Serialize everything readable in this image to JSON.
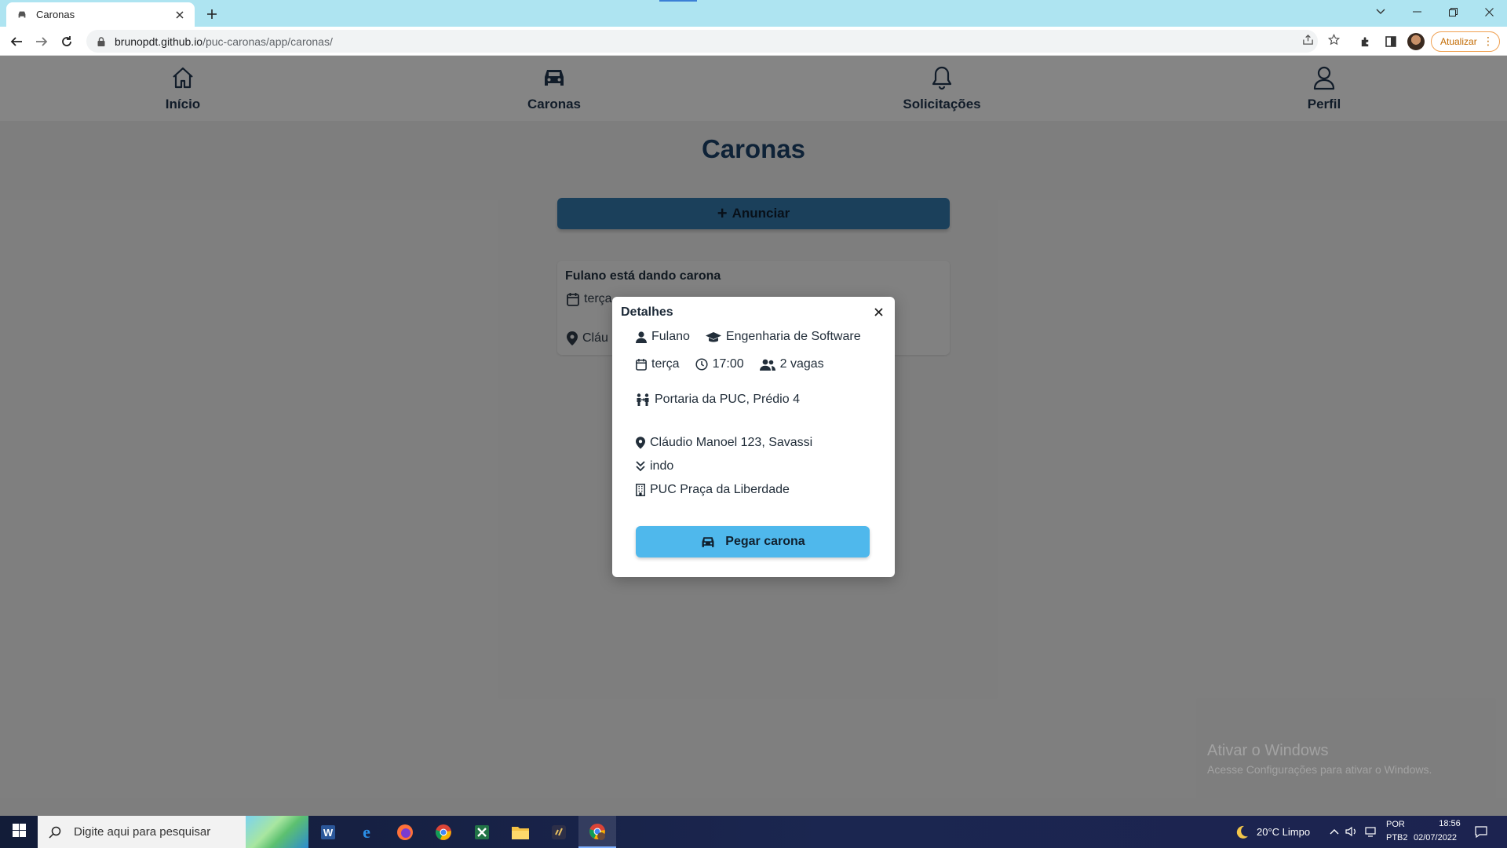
{
  "browser": {
    "tab_title": "Caronas",
    "url_host": "brunopdt.github.io",
    "url_path": "/puc-caronas/app/caronas/",
    "update_label": "Atualizar"
  },
  "nav": {
    "items": [
      {
        "label": "Início",
        "icon": "home-icon"
      },
      {
        "label": "Caronas",
        "icon": "car-icon"
      },
      {
        "label": "Solicitações",
        "icon": "bell-icon"
      },
      {
        "label": "Perfil",
        "icon": "user-icon"
      }
    ]
  },
  "page": {
    "title": "Caronas",
    "announce_label": "Anunciar"
  },
  "ride_card": {
    "title": "Fulano está dando carona",
    "day_partial": "terça",
    "address_partial": "Cláu"
  },
  "modal": {
    "title": "Detalhes",
    "driver": "Fulano",
    "course": "Engenharia de Software",
    "day": "terça",
    "time": "17:00",
    "seats": "2 vagas",
    "meeting_point": "Portaria da PUC, Prédio 4",
    "origin": "Cláudio Manoel 123, Savassi",
    "direction": "indo",
    "destination": "PUC Praça da Liberdade",
    "action_label": "Pegar carona"
  },
  "watermark": {
    "line1": "Ativar o Windows",
    "line2": "Acesse Configurações para ativar o Windows."
  },
  "taskbar": {
    "search_placeholder": "Digite aqui para pesquisar",
    "weather": "20°C  Limpo",
    "lang_line1": "POR",
    "lang_line2": "PTB2",
    "time": "18:56",
    "date": "02/07/2022"
  },
  "colors": {
    "primary_button": "#2e6c98",
    "action_button": "#4fb8ec",
    "title_text": "#183a5c",
    "tabstrip": "#aee4f1"
  }
}
